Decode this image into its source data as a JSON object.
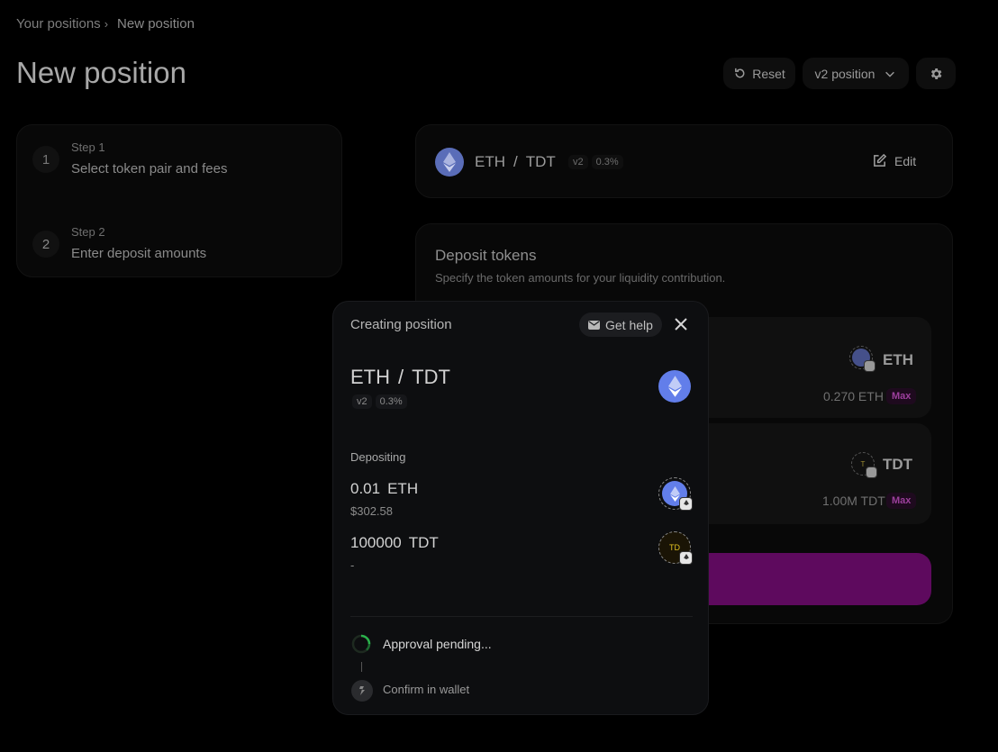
{
  "breadcrumb": {
    "parent": "Your positions",
    "separator": "›",
    "current": "New position"
  },
  "page_title": "New position",
  "header": {
    "reset_label": "Reset",
    "version_label": "v2 position"
  },
  "steps": [
    {
      "num": "1",
      "label": "Step 1",
      "text": "Select token pair and fees"
    },
    {
      "num": "2",
      "label": "Step 2",
      "text": "Enter deposit amounts"
    }
  ],
  "pair_panel": {
    "token0": "ETH",
    "slash": "/",
    "token1": "TDT",
    "version": "v2",
    "fee": "0.3%",
    "edit_label": "Edit"
  },
  "deposit_panel": {
    "title": "Deposit tokens",
    "subtitle": "Specify the token amounts for your liquidity contribution.",
    "tokens": [
      {
        "symbol": "ETH",
        "balance": "0.270 ETH",
        "max": "Max"
      },
      {
        "symbol": "TDT",
        "balance": "1.00M TDT",
        "max": "Max",
        "logo_text": "T"
      }
    ]
  },
  "modal": {
    "title": "Creating position",
    "help_label": "Get help",
    "pair": {
      "token0": "ETH",
      "slash": "/",
      "token1": "TDT",
      "version": "v2",
      "fee": "0.3%"
    },
    "depositing_label": "Depositing",
    "deposits": [
      {
        "amount": "0.01",
        "symbol": "ETH",
        "usd": "$302.58"
      },
      {
        "amount": "100000",
        "symbol": "TDT",
        "usd": "-",
        "logo_text": "TD"
      }
    ],
    "status": [
      {
        "text": "Approval pending..."
      },
      {
        "text": "Confirm in wallet"
      }
    ]
  },
  "colors": {
    "accent": "#5e0a5e",
    "eth": "#627eea",
    "spinner": "#2bb24c"
  }
}
